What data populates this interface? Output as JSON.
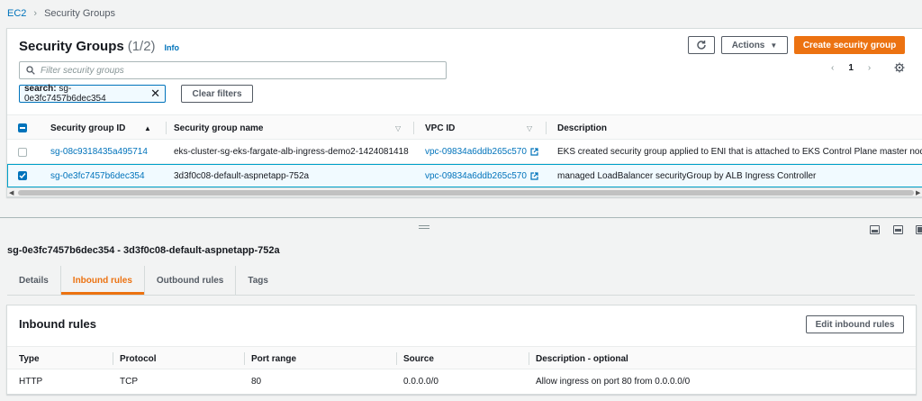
{
  "breadcrumb": {
    "root": "EC2",
    "current": "Security Groups"
  },
  "list": {
    "title": "Security Groups",
    "count": "(1/2)",
    "info": "Info",
    "refresh_icon": "refresh-icon",
    "actions_label": "Actions",
    "create_label": "Create security group",
    "search_placeholder": "Filter security groups",
    "filter_token": {
      "key": "search:",
      "value": "sg-0e3fc7457b6dec354"
    },
    "clear_filters": "Clear filters",
    "page": "1",
    "columns": [
      "Security group ID",
      "Security group name",
      "VPC ID",
      "Description"
    ],
    "rows": [
      {
        "selected": false,
        "id": "sg-08c9318435a495714",
        "name": "eks-cluster-sg-eks-fargate-alb-ingress-demo2-1424081418",
        "vpc": "vpc-09834a6ddb265c570",
        "description": "EKS created security group applied to ENI that is attached to EKS Control Plane master nodes, as"
      },
      {
        "selected": true,
        "id": "sg-0e3fc7457b6dec354",
        "name": "3d3f0c08-default-aspnetapp-752a",
        "vpc": "vpc-09834a6ddb265c570",
        "description": "managed LoadBalancer securityGroup by ALB Ingress Controller"
      }
    ]
  },
  "detail": {
    "title": "sg-0e3fc7457b6dec354 - 3d3f0c08-default-aspnetapp-752a",
    "tabs": [
      "Details",
      "Inbound rules",
      "Outbound rules",
      "Tags"
    ],
    "active_tab": "Inbound rules",
    "inbound": {
      "title": "Inbound rules",
      "edit_label": "Edit inbound rules",
      "columns": [
        "Type",
        "Protocol",
        "Port range",
        "Source",
        "Description - optional"
      ],
      "rows": [
        {
          "type": "HTTP",
          "protocol": "TCP",
          "port": "80",
          "source": "0.0.0.0/0",
          "description": "Allow ingress on port 80 from 0.0.0.0/0"
        }
      ]
    }
  },
  "colors": {
    "accent": "#ec7211",
    "link": "#0073bb",
    "selected_bg": "#f1faff",
    "selected_border": "#00a1c9"
  }
}
